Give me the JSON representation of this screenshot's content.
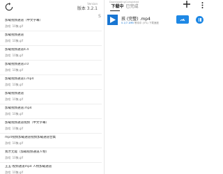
{
  "left": {
    "header": {
      "subtitle": "Version",
      "version": "版本 3.2.1"
    },
    "scroll_indicator": "S",
    "files": [
      {
        "name": "加载视频通道（中文字幕）",
        "meta": "游戏: 10集.gif"
      },
      {
        "name": "加载视频通道",
        "meta": "游戏: 10集.gif"
      },
      {
        "name": "加载视频通道4.4",
        "meta": "游戏: 10集.gif"
      },
      {
        "name": "加载视频通道3.0",
        "meta": "游戏: 10集.gif"
      },
      {
        "name": "加载视频通道1.mp4",
        "meta": "游戏: 10集.gif"
      },
      {
        "name": "加载视频通道",
        "meta": "游戏: 10集.gif"
      },
      {
        "name": "加载视频通道.mp4",
        "meta": "游戏: 10集.gif"
      },
      {
        "name": "加载视频通道视频（中文字幕）",
        "meta": "游戏: 10集.gif"
      },
      {
        "name": "mp4视频加载通道视频加载通道合集",
        "meta": "游戏: 10集.gif"
      },
      {
        "name": "我才无能（加载视频通道人物）",
        "meta": "游戏: 10集.gif"
      },
      {
        "name": "王五-视频通道mp4 人物加载通道",
        "meta": "游戏: 10集.gif"
      }
    ]
  },
  "right": {
    "tabs": [
      {
        "sub": "Downloading",
        "label": "下载中"
      },
      {
        "sub": "Completed",
        "label": "已完成"
      }
    ],
    "download": {
      "name": "孩 (完整) .mp4",
      "progress_text": "0.1/7.1MB",
      "status_text": "等待中 (0%) 下载速度"
    }
  },
  "colors": {
    "accent": "#1976d2",
    "accent_light": "#1e88e5"
  }
}
